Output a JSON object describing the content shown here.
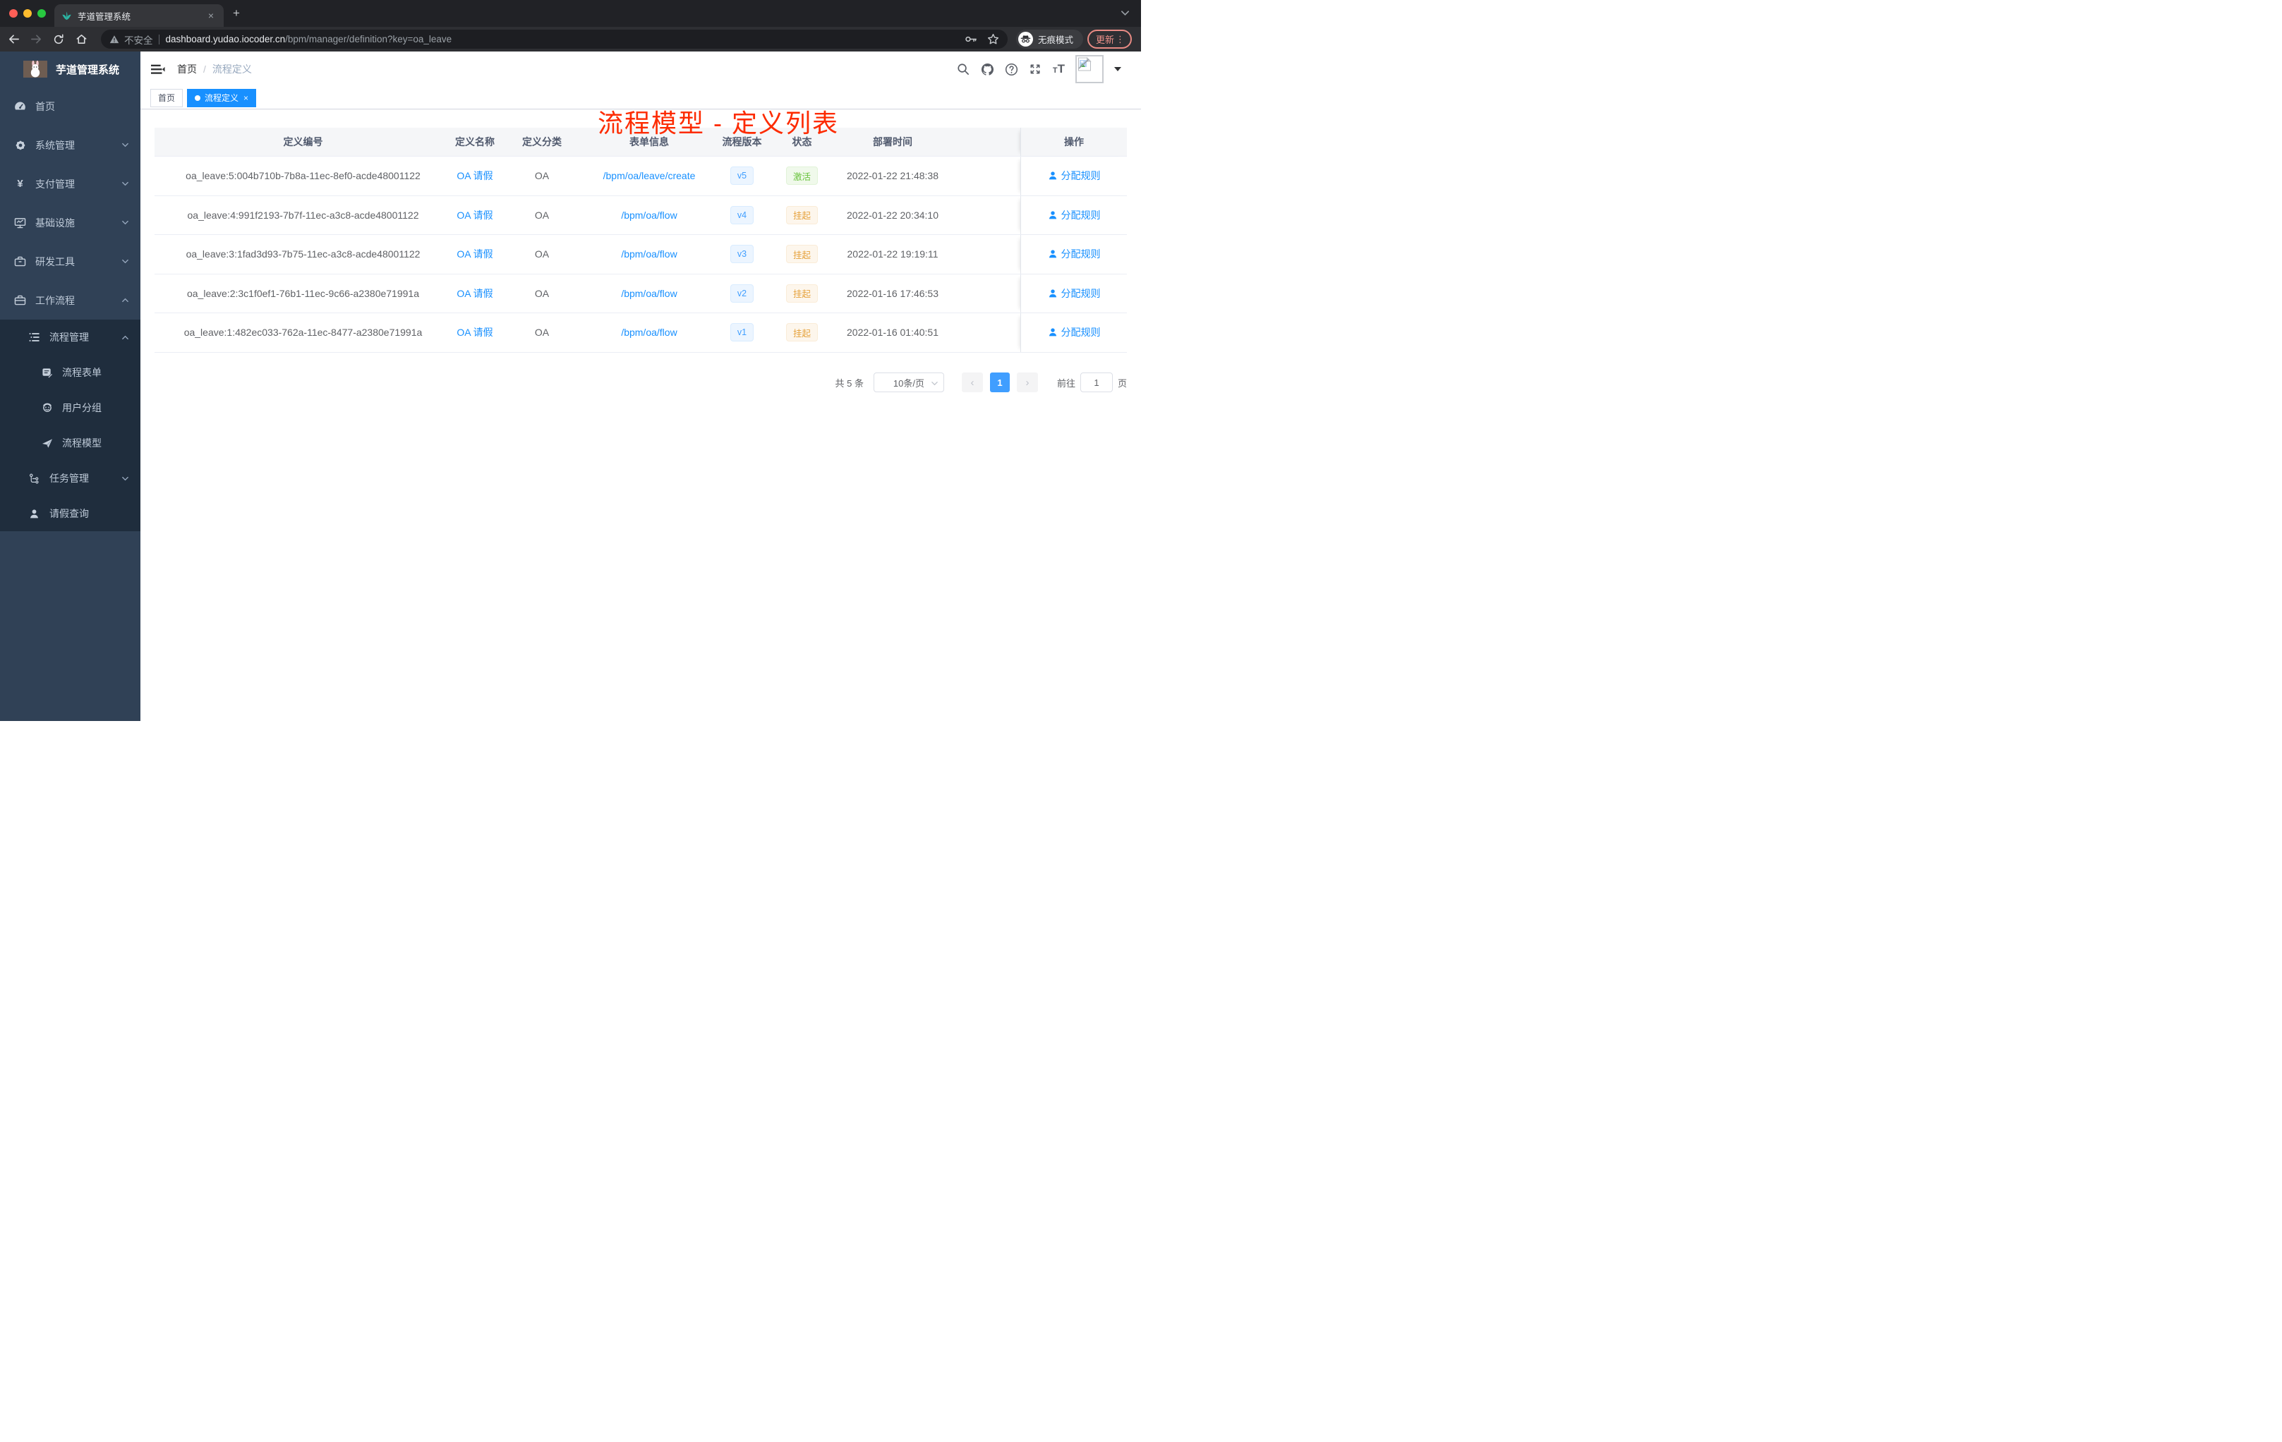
{
  "browser": {
    "tab_title": "芋道管理系统",
    "close_tab": "×",
    "new_tab": "+",
    "security_label": "不安全",
    "url_domain": "dashboard.yudao.iocoder.cn",
    "url_path": "/bpm/manager/definition?key=oa_leave",
    "incognito_label": "无痕模式",
    "update_label": "更新",
    "menu_dots": "⋮"
  },
  "sidebar": {
    "title": "芋道管理系统",
    "items": [
      {
        "label": "首页"
      },
      {
        "label": "系统管理"
      },
      {
        "label": "支付管理"
      },
      {
        "label": "基础设施"
      },
      {
        "label": "研发工具"
      },
      {
        "label": "工作流程"
      },
      {
        "label": "流程管理"
      },
      {
        "label": "流程表单"
      },
      {
        "label": "用户分组"
      },
      {
        "label": "流程模型"
      },
      {
        "label": "任务管理"
      },
      {
        "label": "请假查询"
      }
    ]
  },
  "navbar": {
    "breadcrumb_home": "首页",
    "breadcrumb_sep": "/",
    "breadcrumb_current": "流程定义"
  },
  "annotation": {
    "title": "流程模型 - 定义列表"
  },
  "tags": {
    "home": "首页",
    "active": "流程定义",
    "close": "×"
  },
  "table": {
    "headers": [
      "定义编号",
      "定义名称",
      "定义分类",
      "表单信息",
      "流程版本",
      "状态",
      "部署时间",
      "操作"
    ],
    "rows": [
      {
        "id": "oa_leave:5:004b710b-7b8a-11ec-8ef0-acde48001122",
        "name": "OA 请假",
        "category": "OA",
        "form": "/bpm/oa/leave/create",
        "version": "v5",
        "status": "激活",
        "status_type": "success",
        "time": "2022-01-22 21:48:38",
        "action": "分配规则"
      },
      {
        "id": "oa_leave:4:991f2193-7b7f-11ec-a3c8-acde48001122",
        "name": "OA 请假",
        "category": "OA",
        "form": "/bpm/oa/flow",
        "version": "v4",
        "status": "挂起",
        "status_type": "warning",
        "time": "2022-01-22 20:34:10",
        "action": "分配规则"
      },
      {
        "id": "oa_leave:3:1fad3d93-7b75-11ec-a3c8-acde48001122",
        "name": "OA 请假",
        "category": "OA",
        "form": "/bpm/oa/flow",
        "version": "v3",
        "status": "挂起",
        "status_type": "warning",
        "time": "2022-01-22 19:19:11",
        "action": "分配规则"
      },
      {
        "id": "oa_leave:2:3c1f0ef1-76b1-11ec-9c66-a2380e71991a",
        "name": "OA 请假",
        "category": "OA",
        "form": "/bpm/oa/flow",
        "version": "v2",
        "status": "挂起",
        "status_type": "warning",
        "time": "2022-01-16 17:46:53",
        "action": "分配规则"
      },
      {
        "id": "oa_leave:1:482ec033-762a-11ec-8477-a2380e71991a",
        "name": "OA 请假",
        "category": "OA",
        "form": "/bpm/oa/flow",
        "version": "v1",
        "status": "挂起",
        "status_type": "warning",
        "time": "2022-01-16 01:40:51",
        "action": "分配规则"
      }
    ]
  },
  "pagination": {
    "total": "共 5 条",
    "page_size": "10条/页",
    "prev": "‹",
    "next": "›",
    "current": "1",
    "goto_label": "前往",
    "goto_value": "1",
    "unit": "页"
  }
}
